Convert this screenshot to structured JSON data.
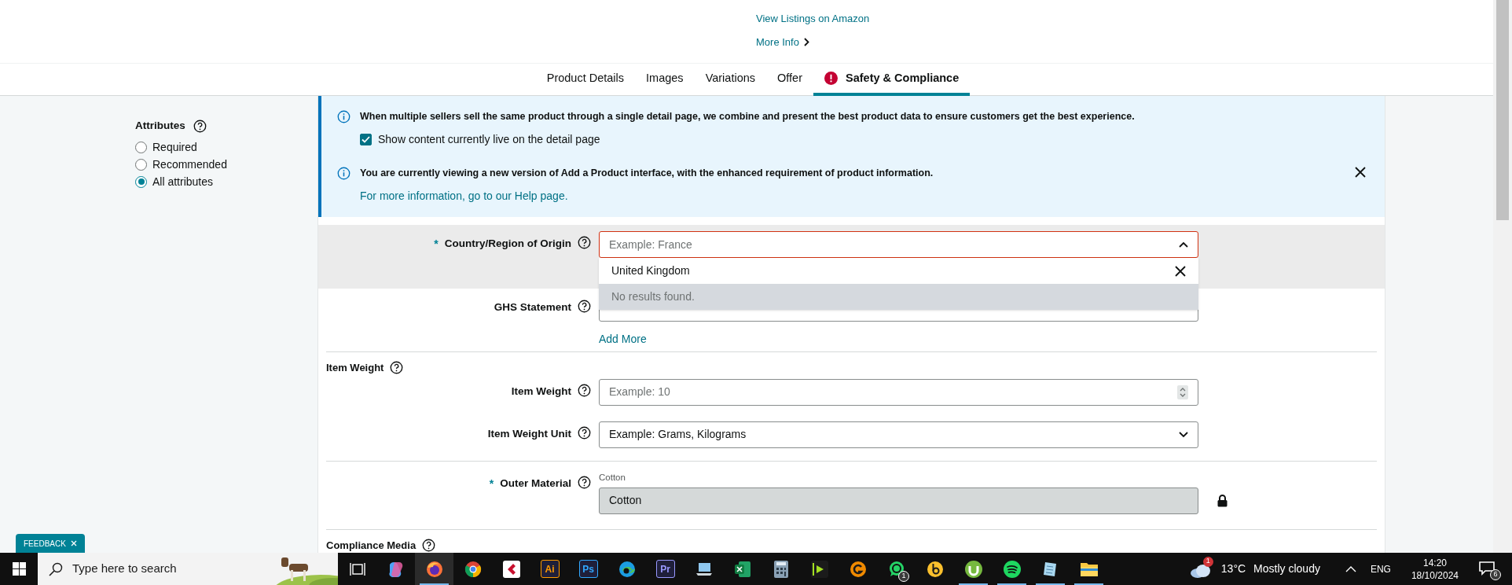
{
  "header": {
    "links": [
      {
        "label": "View Listings on Amazon",
        "chevron": false
      },
      {
        "label": "More Info",
        "chevron": true
      }
    ]
  },
  "tabs": [
    {
      "label": "Product Details",
      "selected": false,
      "alert": false
    },
    {
      "label": "Images",
      "selected": false,
      "alert": false
    },
    {
      "label": "Variations",
      "selected": false,
      "alert": false
    },
    {
      "label": "Offer",
      "selected": false,
      "alert": false
    },
    {
      "label": "Safety & Compliance",
      "selected": true,
      "alert": true
    }
  ],
  "sidebar": {
    "title": "Attributes",
    "options": [
      {
        "label": "Required",
        "selected": false
      },
      {
        "label": "Recommended",
        "selected": false
      },
      {
        "label": "All attributes",
        "selected": true
      }
    ]
  },
  "banner": {
    "notices": [
      {
        "text": "When multiple sellers sell the same product through a single detail page, we combine and present the best product data to ensure customers get the best experience.",
        "checkbox": {
          "label": "Show content currently live on the detail page",
          "checked": true
        },
        "dismissible": false
      },
      {
        "text": "You are currently viewing a new version of Add a Product interface, with the enhanced requirement of product information.",
        "link": "For more information, go to our Help page.",
        "dismissible": true
      }
    ]
  },
  "form": {
    "sections": [
      {
        "rows": [
          {
            "kind": "combobox",
            "label": "Country/Region of Origin",
            "marker": "*",
            "placeholder": "Example: France",
            "highlighted": true,
            "dropdown": {
              "option": "United Kingdom",
              "message": "No results found."
            }
          },
          {
            "kind": "text",
            "label": "GHS Statement",
            "add_more": "Add More"
          }
        ]
      },
      {
        "title": "Item Weight",
        "rows": [
          {
            "kind": "number",
            "label": "Item Weight",
            "placeholder": "Example: 10"
          },
          {
            "kind": "select",
            "label": "Item Weight Unit",
            "placeholder": "Example: Grams, Kilograms"
          }
        ]
      },
      {
        "rows": [
          {
            "kind": "locked",
            "label": "Outer Material",
            "marker": "*",
            "caption": "Cotton",
            "value": "Cotton"
          }
        ]
      },
      {
        "title": "Compliance Media"
      }
    ]
  },
  "feedback": {
    "label": "FEEDBACK"
  },
  "taskbar": {
    "search_placeholder": "Type here to search",
    "apps": [
      {
        "kind": "taskview",
        "active": false
      },
      {
        "kind": "copilot",
        "active": false
      },
      {
        "kind": "firefox",
        "active": true
      },
      {
        "kind": "chrome",
        "active": false
      },
      {
        "kind": "cakewalk",
        "active": false
      },
      {
        "kind": "letter",
        "text": "Ai",
        "color": "#ff9a00",
        "active": false
      },
      {
        "kind": "letter",
        "text": "Ps",
        "color": "#31a8ff",
        "active": false
      },
      {
        "kind": "edge",
        "active": false
      },
      {
        "kind": "letter",
        "text": "Pr",
        "color": "#9999ff",
        "active": false
      },
      {
        "kind": "laptop",
        "active": false
      },
      {
        "kind": "excel",
        "active": false
      },
      {
        "kind": "calculator",
        "active": false
      },
      {
        "kind": "player",
        "active": false
      },
      {
        "kind": "gbadge",
        "active": false
      },
      {
        "kind": "whatsapp",
        "badge": "1",
        "active": false
      },
      {
        "kind": "yellow",
        "active": false
      },
      {
        "kind": "utorrent",
        "active": true
      },
      {
        "kind": "spotify",
        "active": true
      },
      {
        "kind": "notepad",
        "active": true
      },
      {
        "kind": "folder",
        "active": true
      }
    ],
    "weather": {
      "badge": "1",
      "temp": "13°C",
      "condition": "Mostly cloudy"
    },
    "language": "ENG",
    "time": "14:20",
    "date": "18/10/2024",
    "notifications": "6"
  }
}
